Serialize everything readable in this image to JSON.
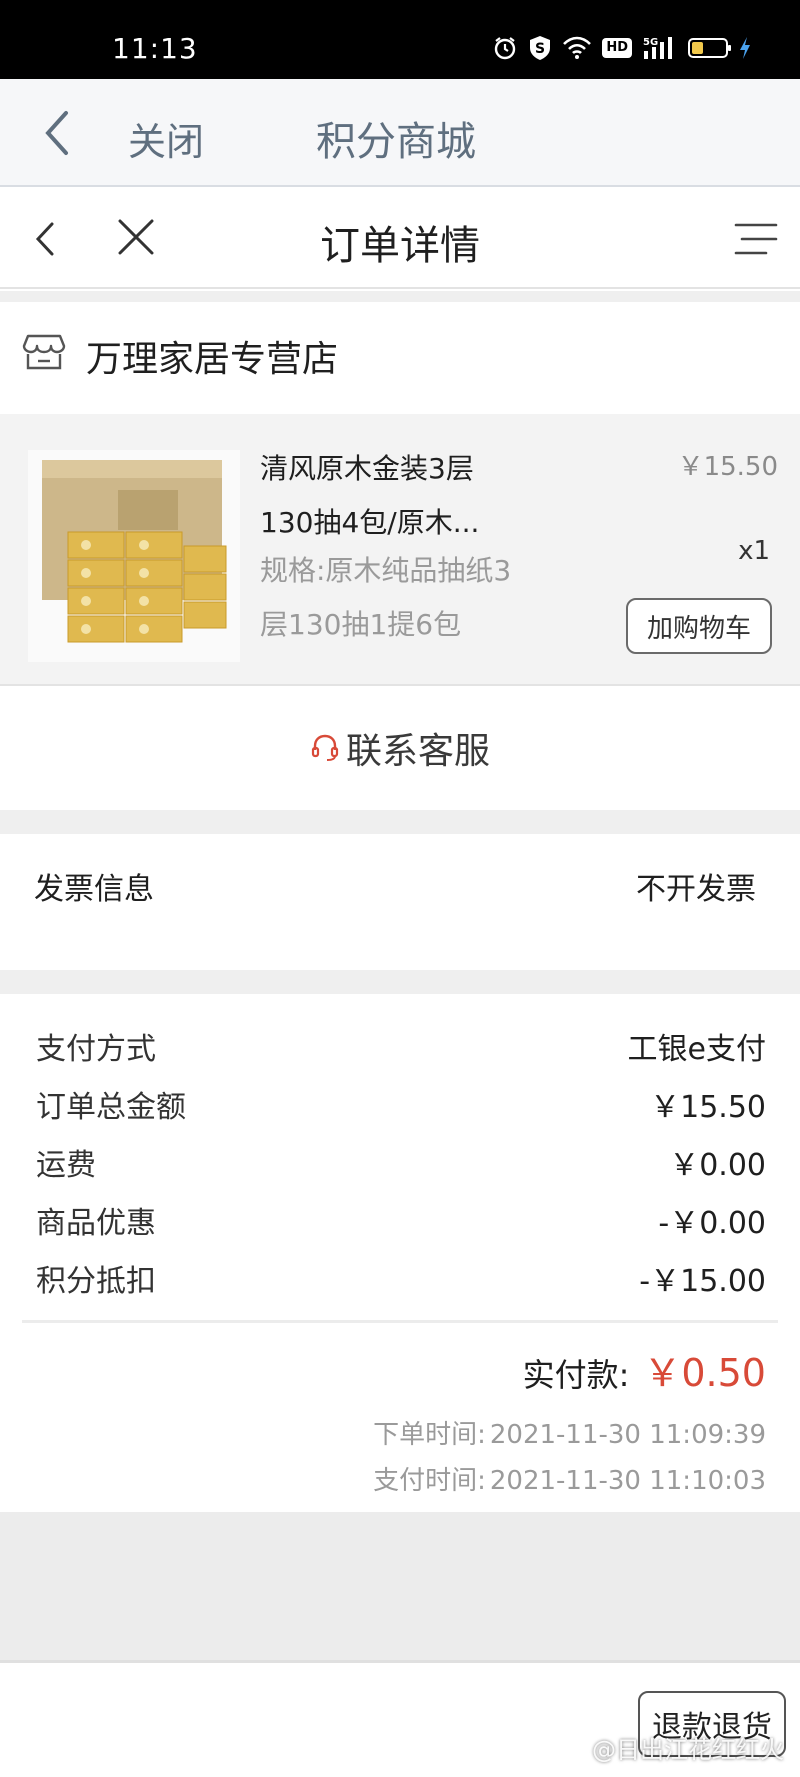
{
  "status_bar": {
    "time": "11:13",
    "icons": [
      "alarm-icon",
      "shield-s-icon",
      "wifi-icon",
      "hd-icon",
      "5g-signal-icon",
      "battery-icon",
      "charging-icon"
    ],
    "hd_label": "HD",
    "network_label": "5G",
    "battery_level": 0.3
  },
  "app_header": {
    "close_label": "关闭",
    "title": "积分商城"
  },
  "nav": {
    "title": "订单详情"
  },
  "store": {
    "name": "万理家居专营店"
  },
  "product": {
    "name_line1": "清风原木金装3层",
    "name_line2": "130抽4包/原木...",
    "spec_line1": "规格:原木纯品抽纸3",
    "spec_line2": "层130抽1提6包",
    "price": "￥15.50",
    "quantity": "x1",
    "add_to_cart_label": "加购物车"
  },
  "service": {
    "label": "联系客服"
  },
  "invoice": {
    "label": "发票信息",
    "value": "不开发票"
  },
  "payment": {
    "rows": [
      {
        "label": "支付方式",
        "value": "工银e支付"
      },
      {
        "label": "订单总金额",
        "value": "￥15.50"
      },
      {
        "label": "运费",
        "value": "￥0.00"
      },
      {
        "label": "商品优惠",
        "value": "-￥0.00"
      },
      {
        "label": "积分抵扣",
        "value": "-￥15.00"
      }
    ],
    "actual_label": "实付款:",
    "actual_value": "￥0.50",
    "order_time_label": "下单时间:",
    "order_time": "2021-11-30 11:09:39",
    "pay_time_label": "支付时间:",
    "pay_time": "2021-11-30 11:10:03"
  },
  "footer": {
    "refund_label": "退款退货",
    "watermark": "@日出江花红红火"
  },
  "colors": {
    "accent_red": "#d84a38",
    "header_text": "#5f6f7f",
    "muted_text": "#9a9a9a"
  }
}
